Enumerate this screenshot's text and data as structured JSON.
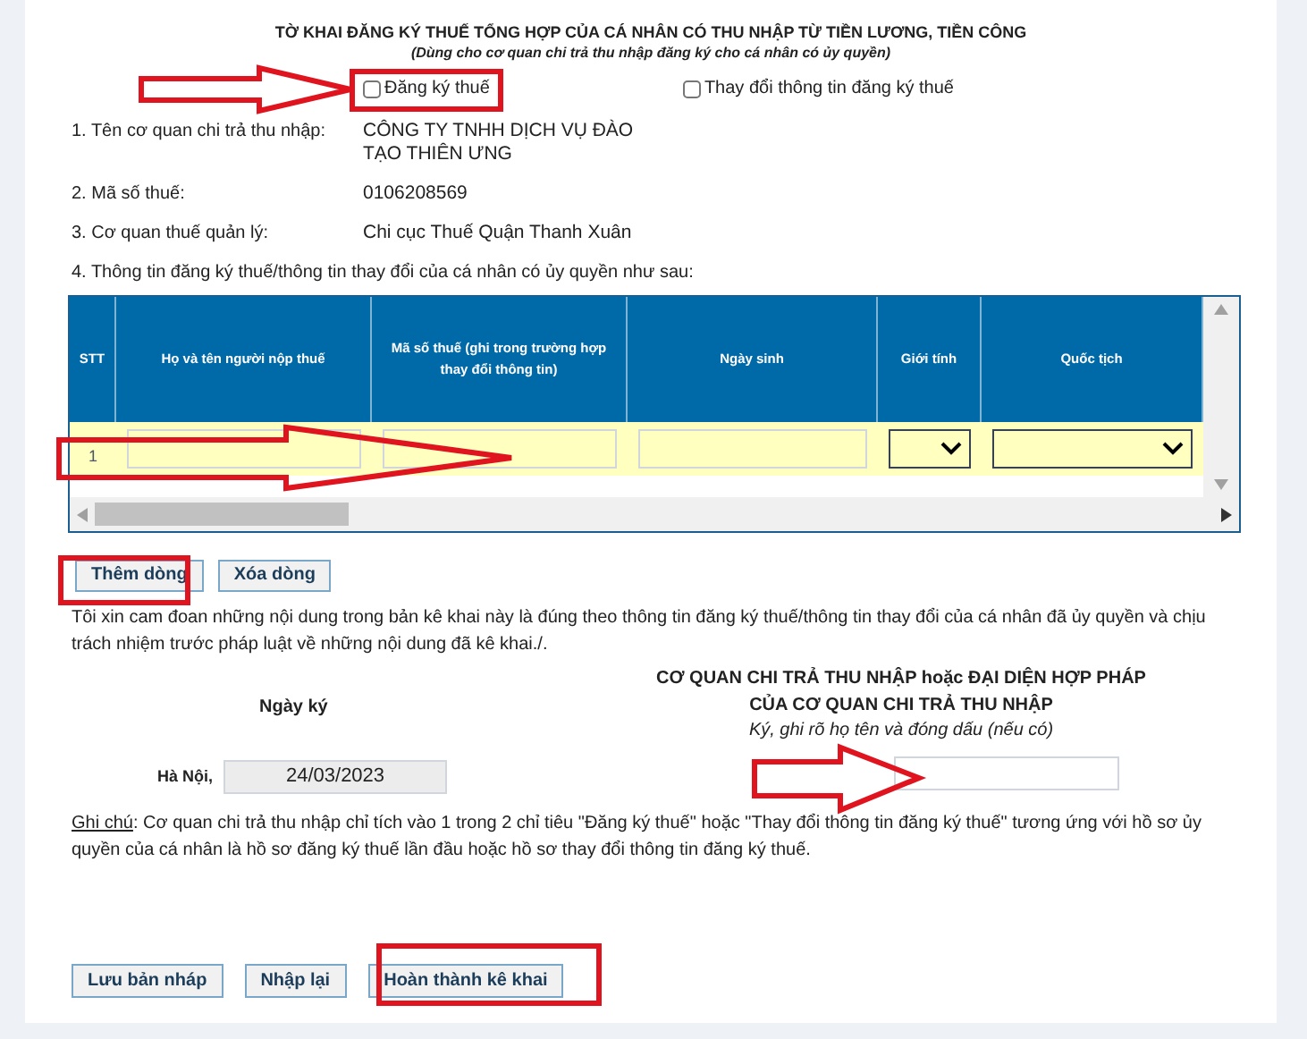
{
  "form": {
    "title": "TỜ KHAI ĐĂNG KÝ THUẾ TỔNG HỢP CỦA CÁ NHÂN CÓ THU NHẬP TỪ TIỀN LƯƠNG, TIỀN CÔNG",
    "subtitle": "(Dùng cho cơ quan chi trả thu nhập đăng ký cho cá nhân có ủy quyền)",
    "options": [
      {
        "label": "Đăng ký thuế",
        "checked": false
      },
      {
        "label": "Thay đổi thông tin đăng ký thuế",
        "checked": false
      }
    ]
  },
  "info": [
    {
      "label": "1. Tên cơ quan chi trả thu nhập:",
      "value": "CÔNG TY TNHH DỊCH VỤ ĐÀO TẠO THIÊN ƯNG"
    },
    {
      "label": "2. Mã số thuế:",
      "value": "0106208569"
    },
    {
      "label": "3. Cơ quan thuế quản lý:",
      "value": "Chi cục Thuế Quận Thanh Xuân"
    }
  ],
  "section_label": "4. Thông tin đăng ký thuế/thông tin thay đổi của cá nhân có ủy quyền như sau:",
  "table": {
    "columns": [
      {
        "label": "STT",
        "kind": "index"
      },
      {
        "label": "Họ và tên người nộp thuế",
        "kind": "text"
      },
      {
        "label": "Mã số thuế (ghi trong trường hợp thay đổi thông tin)",
        "kind": "text"
      },
      {
        "label": "Ngày sinh",
        "kind": "text"
      },
      {
        "label": "Giới tính",
        "kind": "select"
      },
      {
        "label": "Quốc tịch",
        "kind": "select"
      }
    ],
    "rows": [
      {
        "stt": "1"
      }
    ]
  },
  "row_buttons": [
    "Thêm dòng",
    "Xóa dòng"
  ],
  "declaration": "Tôi xin cam đoan những nội dung trong bản kê khai này là đúng theo thông tin đăng ký thuế/thông tin thay đổi của cá nhân đã ủy quyền và chịu trách nhiệm trước pháp luật về những nội dung đã kê khai./.",
  "sign_date": {
    "label": "Ngày ký",
    "place": "Hà Nội,",
    "value": "24/03/2023"
  },
  "payer": {
    "heading": [
      "CƠ QUAN CHI TRẢ THU NHẬP hoặc ĐẠI DIỆN HỢP PHÁP",
      "CỦA CƠ QUAN CHI TRẢ THU NHẬP"
    ],
    "hint": "Ký, ghi rõ họ tên và đóng dấu (nếu có)"
  },
  "note": {
    "label": "Ghi chú",
    "text": ": Cơ quan chi trả thu nhập chỉ tích vào 1 trong 2 chỉ tiêu \"Đăng ký thuế\" hoặc \"Thay đổi thông tin đăng ký thuế\" tương ứng với hồ sơ ủy quyền của cá nhân là hồ sơ đăng ký thuế lần đầu hoặc hồ sơ thay đổi thông tin đăng ký thuế."
  },
  "actions": [
    "Lưu bản nháp",
    "Nhập lại",
    "Hoàn thành kê khai"
  ]
}
